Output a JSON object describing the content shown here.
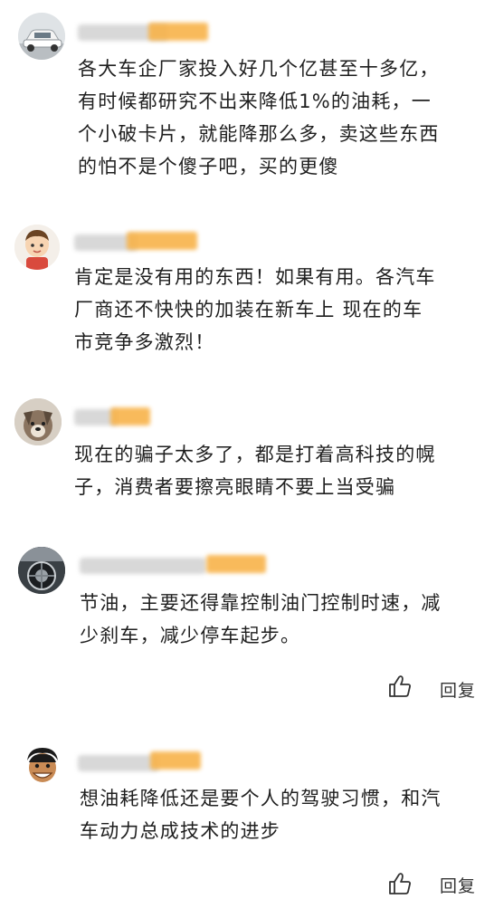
{
  "comments": [
    {
      "text_lines": [
        "各大车企厂家投入好几个亿甚至十多亿，",
        "有时候都研究不出来降低1%的油耗，一",
        "个小破卡片，就能降那么多，卖这些东西",
        "的怕不是个傻子吧，买的更傻"
      ]
    },
    {
      "text_lines": [
        "肯定是没有用的东西！如果有用。各汽车",
        "厂商还不快快的加装在新车上 现在的车",
        "市竞争多激烈！"
      ]
    },
    {
      "text_lines": [
        "现在的骗子太多了，都是打着高科技的幌",
        "子，消费者要擦亮眼睛不要上当受骗"
      ]
    },
    {
      "text_lines": [
        "节油，主要还得靠控制油门控制时速，减",
        "少刹车，减少停车起步。"
      ],
      "reply_label": "回复"
    },
    {
      "text_lines": [
        "想油耗降低还是要个人的驾驶习惯，和汽",
        "车动力总成技术的进步"
      ],
      "reply_label": "回复"
    }
  ]
}
